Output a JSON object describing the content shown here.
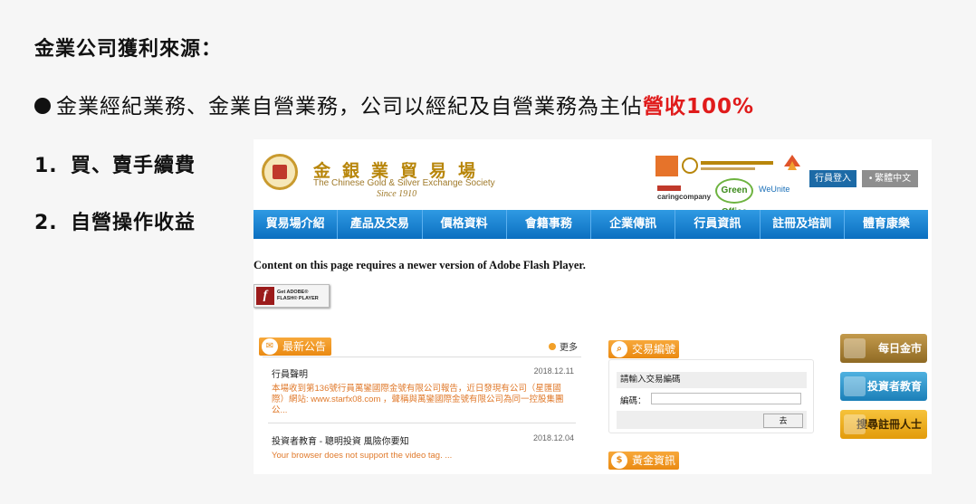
{
  "slide": {
    "title": "金業公司獲利來源：",
    "bullet_text": "金業經紀業務、金業自營業務，公司以經紀及自營業務為主佔",
    "bullet_highlight": "營收100%",
    "highlight_color": "#e01b1b",
    "items": [
      {
        "num": "1.",
        "label": "買、賣手續費"
      },
      {
        "num": "2.",
        "label": "自營操作收益"
      }
    ]
  },
  "site": {
    "logo_zh": "金銀業貿易場",
    "logo_en": "The Chinese Gold & Silver Exchange Society",
    "logo_since": "Since 1910",
    "partner_caring": "caringcompany",
    "partner_green": "Green Office",
    "partner_weunite": "WeUnite",
    "login_label": "行員登入",
    "lang_label": "• 繁體中文",
    "nav": [
      "貿易場介紹",
      "產品及交易",
      "價格資料",
      "會籍事務",
      "企業傳訊",
      "行員資訊",
      "註冊及培訓",
      "體育康樂"
    ],
    "flash_message": "Content on this page requires a newer version of Adobe Flash Player.",
    "flash_button_line1": "Get ADOBE®",
    "flash_button_line2": "FLASH® PLAYER",
    "news": {
      "tag": "最新公告",
      "more": "更多",
      "entries": [
        {
          "title": "行員聲明",
          "date": "2018.12.11",
          "body": "本場收到第136號行員萬鑾國際金號有限公司報告，近日發現有公司（星匯國際）網站: www.starfx08.com ，聲稱與萬鑾國際金號有限公司為同一控股集團公..."
        },
        {
          "title": "投資者教育 - 聰明投資 風險你要知",
          "date": "2018.12.04",
          "body": "Your browser does not support the video tag. ..."
        }
      ]
    },
    "trade": {
      "tag": "交易編號",
      "prompt": "請輸入交易編碼",
      "code_label": "編碼：",
      "go": "去"
    },
    "gold_tag": "黃金資訊",
    "side_buttons": {
      "daily": "每日金市",
      "edu": "投資者教育",
      "search": "搜尋註冊人士"
    }
  }
}
